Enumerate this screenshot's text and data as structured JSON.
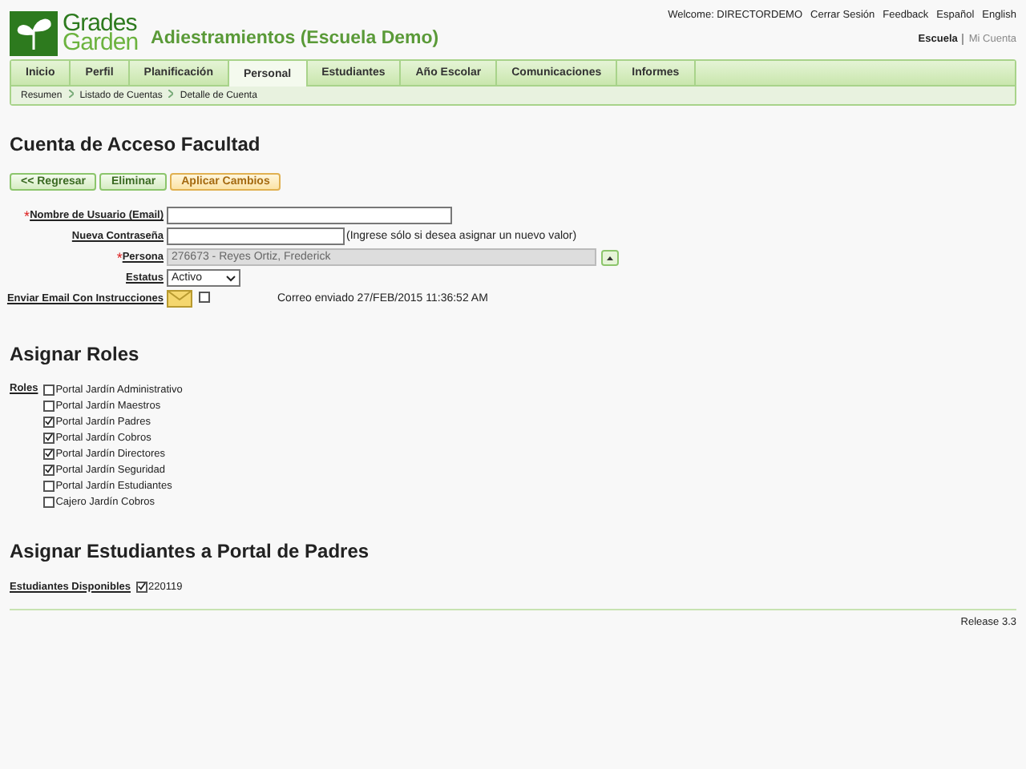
{
  "header": {
    "logo_line_1": "Grades",
    "logo_line_2": "Garden",
    "title": "Adiestramientos (Escuela Demo)",
    "top_links": [
      "Welcome: DIRECTORDEMO",
      "Cerrar Sesión",
      "Feedback",
      "Español",
      "English"
    ],
    "context_links": [
      {
        "label": "Escuela",
        "selected": true
      },
      {
        "label": "Mi Cuenta",
        "selected": false
      }
    ]
  },
  "nav_tabs": [
    {
      "label": "Inicio",
      "selected": false
    },
    {
      "label": "Perfil",
      "selected": false
    },
    {
      "label": "Planificación",
      "selected": false
    },
    {
      "label": "Personal",
      "selected": true
    },
    {
      "label": "Estudiantes",
      "selected": false
    },
    {
      "label": "Año Escolar",
      "selected": false
    },
    {
      "label": "Comunicaciones",
      "selected": false
    },
    {
      "label": "Informes",
      "selected": false
    }
  ],
  "breadcrumb": [
    "Resumen",
    "Listado de Cuentas",
    "Detalle de Cuenta"
  ],
  "page_title": "Cuenta de Acceso Facultad",
  "buttons": [
    {
      "label": "<< Regresar",
      "kind": "normal"
    },
    {
      "label": "Eliminar",
      "kind": "normal"
    },
    {
      "label": "Aplicar Cambios",
      "kind": "primary"
    }
  ],
  "form": [
    {
      "kind": "text",
      "label": "Nombre de Usuario (Email)",
      "required_mark": "*"
    },
    {
      "kind": "text",
      "label": "Nueva Contraseña",
      "hint": "(Ingrese sólo si desea asignar un nuevo valor)"
    },
    {
      "kind": "lookup",
      "label": "Persona",
      "required_mark": "*",
      "value": "276673 - Reyes Ortiz, Frederick"
    },
    {
      "kind": "select",
      "label": "Estatus",
      "value": "Activo"
    },
    {
      "kind": "email",
      "label": "Enviar Email Con Instrucciones",
      "checked": false,
      "note": "Correo enviado 27/FEB/2015 11:36:52 AM"
    }
  ],
  "roles_section": {
    "title": "Asignar Roles",
    "label": "Roles",
    "roles": [
      {
        "label": "Portal Jardín Administrativo",
        "checked": false
      },
      {
        "label": "Portal Jardín Maestros",
        "checked": false
      },
      {
        "label": "Portal Jardín Padres",
        "checked": true
      },
      {
        "label": "Portal Jardín Cobros",
        "checked": true
      },
      {
        "label": "Portal Jardín Directores",
        "checked": true
      },
      {
        "label": "Portal Jardín Seguridad",
        "checked": true
      },
      {
        "label": "Portal Jardín Estudiantes",
        "checked": false
      },
      {
        "label": "Cajero Jardín Cobros",
        "checked": false
      }
    ]
  },
  "students_section": {
    "title": "Asignar Estudiantes a Portal de Padres",
    "label": "Estudiantes Disponibles",
    "students": [
      {
        "label": "220119",
        "checked": true
      }
    ]
  },
  "footer": {
    "release": "Release 3.3"
  }
}
